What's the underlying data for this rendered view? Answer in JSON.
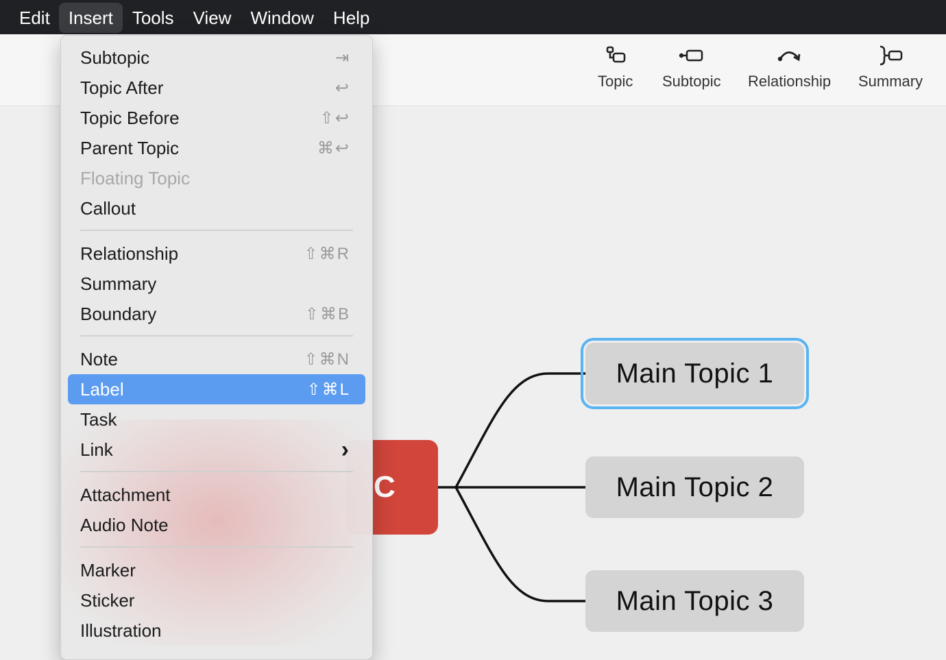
{
  "menubar": {
    "items": [
      "Edit",
      "Insert",
      "Tools",
      "View",
      "Window",
      "Help"
    ]
  },
  "toolbar": {
    "topic": "Topic",
    "subtopic": "Subtopic",
    "relationship": "Relationship",
    "summary": "Summary"
  },
  "menu": {
    "subtopic": {
      "label": "Subtopic",
      "shortcut": "⇥"
    },
    "topic_after": {
      "label": "Topic After",
      "shortcut": "↩"
    },
    "topic_before": {
      "label": "Topic Before",
      "shortcut": "⇧↩"
    },
    "parent_topic": {
      "label": "Parent Topic",
      "shortcut": "⌘↩"
    },
    "floating_topic": {
      "label": "Floating Topic"
    },
    "callout": {
      "label": "Callout"
    },
    "relationship": {
      "label": "Relationship",
      "shortcut": "⇧⌘R"
    },
    "summary": {
      "label": "Summary"
    },
    "boundary": {
      "label": "Boundary",
      "shortcut": "⇧⌘B"
    },
    "note": {
      "label": "Note",
      "shortcut": "⇧⌘N"
    },
    "label": {
      "label": "Label",
      "shortcut": "⇧⌘L"
    },
    "task": {
      "label": "Task"
    },
    "link": {
      "label": "Link",
      "submenu_glyph": "›"
    },
    "attachment": {
      "label": "Attachment"
    },
    "audio_note": {
      "label": "Audio Note"
    },
    "marker": {
      "label": "Marker"
    },
    "sticker": {
      "label": "Sticker"
    },
    "illustration": {
      "label": "Illustration"
    }
  },
  "map": {
    "central_visible_text": "C",
    "topics": [
      "Main Topic 1",
      "Main Topic 2",
      "Main Topic 3"
    ]
  },
  "colors": {
    "menubar_bg": "#202124",
    "highlight": "#5b9bf0",
    "central_topic": "#d1453b",
    "selection_outline": "#5ab3f2",
    "topic_bg": "#d4d4d4"
  }
}
